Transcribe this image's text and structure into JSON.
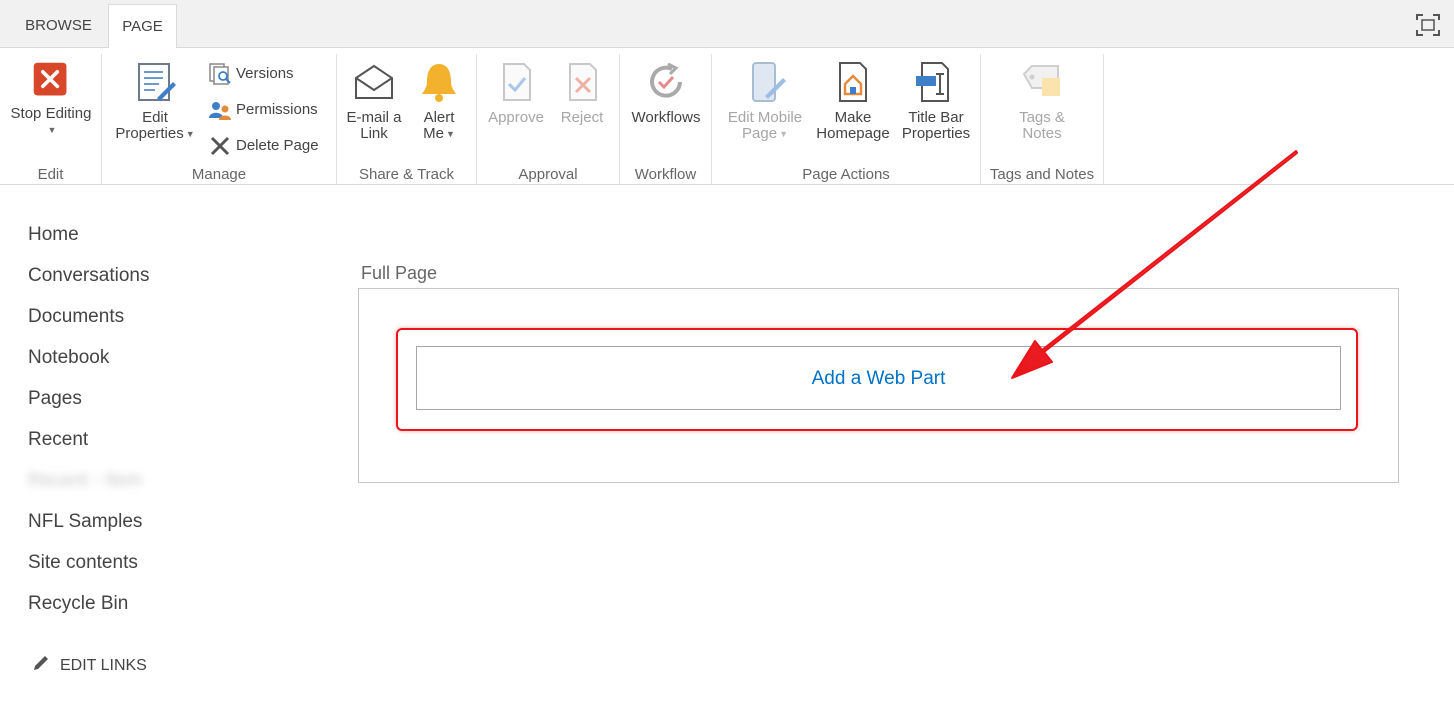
{
  "tabs": [
    {
      "label": "BROWSE",
      "active": false
    },
    {
      "label": "PAGE",
      "active": true
    }
  ],
  "ribbon": {
    "groups": {
      "edit": {
        "label": "Edit",
        "stop_editing": "Stop Editing"
      },
      "manage": {
        "label": "Manage",
        "edit_properties_line1": "Edit",
        "edit_properties_line2": "Properties",
        "versions": "Versions",
        "permissions": "Permissions",
        "delete_page": "Delete Page"
      },
      "share": {
        "label": "Share & Track",
        "email_line1": "E-mail a",
        "email_line2": "Link",
        "alert_line1": "Alert",
        "alert_line2": "Me"
      },
      "approval": {
        "label": "Approval",
        "approve": "Approve",
        "reject": "Reject"
      },
      "workflow": {
        "label": "Workflow",
        "workflows": "Workflows"
      },
      "page_actions": {
        "label": "Page Actions",
        "mobile_line1": "Edit Mobile",
        "mobile_line2": "Page",
        "homepage_line1": "Make",
        "homepage_line2": "Homepage",
        "titlebar_line1": "Title Bar",
        "titlebar_line2": "Properties"
      },
      "tags": {
        "label": "Tags and Notes",
        "tags_line1": "Tags &",
        "tags_line2": "Notes"
      }
    }
  },
  "nav": {
    "items": [
      "Home",
      "Conversations",
      "Documents",
      "Notebook",
      "Pages",
      "Recent",
      "Recent - Item",
      "NFL Samples",
      "Site contents",
      "Recycle Bin"
    ],
    "edit_links": "EDIT LINKS"
  },
  "main": {
    "zone_title": "Full Page",
    "add_web_part": "Add a Web Part"
  },
  "colors": {
    "accent": "#0072c6",
    "annotation_red": "#e8151a",
    "stop_editing_red": "#d9472b"
  }
}
